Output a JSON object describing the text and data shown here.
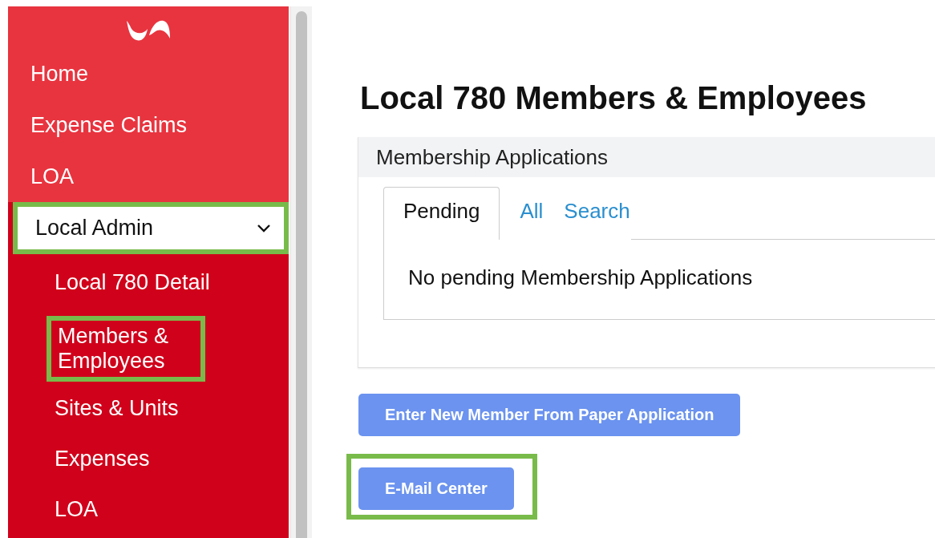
{
  "sidebar": {
    "items": [
      {
        "label": "Home",
        "highlighted": false
      },
      {
        "label": "Expense Claims",
        "highlighted": false
      },
      {
        "label": "LOA",
        "highlighted": false
      },
      {
        "label": "Local Admin",
        "highlighted": true,
        "expanded": true,
        "children": [
          {
            "label": "Local 780 Detail",
            "highlighted": false
          },
          {
            "label": "Members & Employees",
            "highlighted": true
          },
          {
            "label": "Sites & Units",
            "highlighted": false
          },
          {
            "label": "Expenses",
            "highlighted": false
          },
          {
            "label": "LOA",
            "highlighted": false
          }
        ]
      }
    ]
  },
  "page_title": "Local 780 Members & Employees",
  "card": {
    "title": "Membership Applications",
    "tabs": [
      {
        "label": "Pending",
        "selected": true
      },
      {
        "label": "All",
        "selected": false
      },
      {
        "label": "Search",
        "selected": false
      }
    ],
    "message": "No pending Membership Applications"
  },
  "buttons": [
    {
      "label": "Enter New Member From Paper Application",
      "highlighted": false
    },
    {
      "label": "E-Mail Center",
      "highlighted": true
    }
  ]
}
